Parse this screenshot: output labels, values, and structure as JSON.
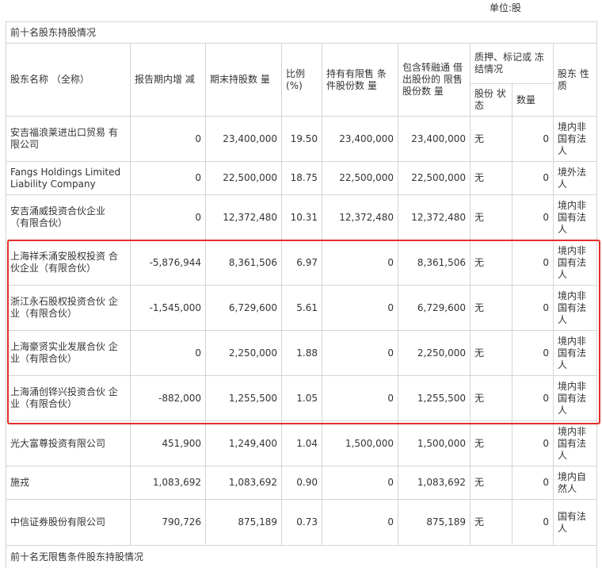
{
  "unit": "单位:股",
  "section_title": "前十名股东持股情况",
  "next_section_title": "前十名无限售条件股东持股情况",
  "headers": {
    "name": "股东名称 （全称）",
    "change": "报告期内增 减",
    "end_shares": "期末持股数 量",
    "ratio": "比例 (%)",
    "restricted": "持有有限售 条件股份数 量",
    "lending": "包含转融通 借出股份的 限售股份数 量",
    "pledge_group": "质押、标记或 冻结情况",
    "pledge_status": "股份 状态",
    "pledge_qty": "数量",
    "nature": "股东 性质"
  },
  "rows": [
    {
      "name": "安吉福浪莱进出口贸易 有限公司",
      "change": "0",
      "end_shares": "23,400,000",
      "ratio": "19.50",
      "restricted": "23,400,000",
      "lending": "23,400,000",
      "status": "无",
      "qty": "0",
      "nature": "境内非国有法人"
    },
    {
      "name": "Fangs Holdings Limited Liability Company",
      "change": "0",
      "end_shares": "22,500,000",
      "ratio": "18.75",
      "restricted": "22,500,000",
      "lending": "22,500,000",
      "status": "无",
      "qty": "0",
      "nature": "境外法人"
    },
    {
      "name": "安吉涌威投资合伙企业 （有限合伙）",
      "change": "0",
      "end_shares": "12,372,480",
      "ratio": "10.31",
      "restricted": "12,372,480",
      "lending": "12,372,480",
      "status": "无",
      "qty": "0",
      "nature": "境内非国有法人"
    },
    {
      "name": "上海祥禾涌安股权投资 合伙企业（有限合伙）",
      "change": "-5,876,944",
      "end_shares": "8,361,506",
      "ratio": "6.97",
      "restricted": "0",
      "lending": "8,361,506",
      "status": "无",
      "qty": "0",
      "nature": "境内非国有法人"
    },
    {
      "name": "浙江永石股权投资合伙 企业（有限合伙）",
      "change": "-1,545,000",
      "end_shares": "6,729,600",
      "ratio": "5.61",
      "restricted": "0",
      "lending": "6,729,600",
      "status": "无",
      "qty": "0",
      "nature": "境内非国有法人"
    },
    {
      "name": "上海豪贤实业发展合伙 企业（有限合伙）",
      "change": "0",
      "end_shares": "2,250,000",
      "ratio": "1.88",
      "restricted": "0",
      "lending": "2,250,000",
      "status": "无",
      "qty": "0",
      "nature": "境内非国有法人"
    },
    {
      "name": "上海涌创铧兴投资合伙 企业（有限合伙）",
      "change": "-882,000",
      "end_shares": "1,255,500",
      "ratio": "1.05",
      "restricted": "0",
      "lending": "1,255,500",
      "status": "无",
      "qty": "0",
      "nature": "境内非国有法人"
    },
    {
      "name": "光大富尊投资有限公司",
      "change": "451,900",
      "end_shares": "1,249,400",
      "ratio": "1.04",
      "restricted": "1,500,000",
      "lending": "1,500,000",
      "status": "无",
      "qty": "0",
      "nature": "境内非国有法人"
    },
    {
      "name": "施戎",
      "change": "1,083,692",
      "end_shares": "1,083,692",
      "ratio": "0.90",
      "restricted": "0",
      "lending": "1,083,692",
      "status": "无",
      "qty": "0",
      "nature": "境内自然人"
    },
    {
      "name": "中信证券股份有限公司",
      "change": "790,726",
      "end_shares": "875,189",
      "ratio": "0.73",
      "restricted": "0",
      "lending": "875,189",
      "status": "无",
      "qty": "0",
      "nature": "国有法人"
    }
  ],
  "highlight_color": "#e52d2d"
}
